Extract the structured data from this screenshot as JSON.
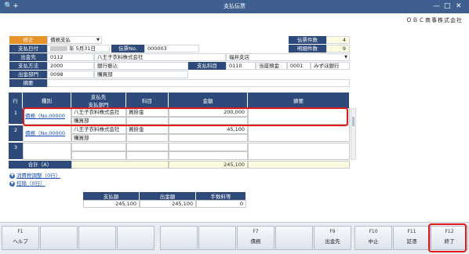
{
  "window": {
    "title": "支払伝票",
    "app_icon": "🔍+",
    "company": "ＯＢＣ商事株式会社"
  },
  "header": {
    "mode_label": "修正",
    "mode_value": "債務支払",
    "date_label": "支払日付",
    "date_value": "年  5月31日",
    "slip_no_label": "伝票No.",
    "slip_no_value": "000003",
    "payee_label": "出金先",
    "payee_code": "0112",
    "payee_name": "八王子衣料株式会社",
    "payee_branch": "福井支店",
    "method_label": "支払方法",
    "method_code": "2000",
    "method_name": "銀行振込",
    "account_label": "支払科目",
    "account_code": "0110",
    "account_name": "当座預金",
    "bank_code": "0001",
    "bank_name": "みずほ銀行",
    "dept_label": "出金部門",
    "dept_code": "0098",
    "dept_name": "購買部",
    "memo_label": "摘要",
    "slip_count_label": "伝票件数",
    "slip_count": "4",
    "detail_count_label": "明細件数",
    "detail_count": "9"
  },
  "grid": {
    "headers": {
      "row": "行",
      "kind": "種別",
      "payee_top": "支払先",
      "payee_bottom": "支払部門",
      "item": "科目",
      "amount": "金額",
      "memo": "摘要"
    },
    "rows": [
      {
        "no": "1",
        "kind": "債務（No.00000",
        "payee": "八王子衣料株式会社",
        "item": "買掛金",
        "dept": "購買部",
        "amount": "200,000"
      },
      {
        "no": "2",
        "kind": "債務（No.00000",
        "payee": "八王子衣料株式会社",
        "item": "買掛金",
        "dept": "購買部",
        "amount": "45,100"
      },
      {
        "no": "3",
        "kind": "",
        "payee": "",
        "item": "",
        "dept": "",
        "amount": ""
      }
    ],
    "total_label": "合計（A）",
    "total_amount": "245,100"
  },
  "links": {
    "tax_adjust": "消費税調整（0行）",
    "deduction": "控除（0行）"
  },
  "summary": {
    "headers": [
      "支払額",
      "出金額",
      "手数料等"
    ],
    "values": [
      "245,100",
      "245,100",
      "0"
    ]
  },
  "fkeys": [
    {
      "key": "F1",
      "label": "ヘルプ"
    },
    {
      "key": "",
      "label": ""
    },
    {
      "key": "",
      "label": ""
    },
    {
      "key": "",
      "label": ""
    },
    {
      "key": "",
      "label": ""
    },
    {
      "key": "",
      "label": ""
    },
    {
      "key": "F7",
      "label": "債務"
    },
    {
      "key": "",
      "label": ""
    },
    {
      "key": "F9",
      "label": "出金先"
    },
    {
      "key": "F10",
      "label": "中止"
    },
    {
      "key": "F11",
      "label": "証憑"
    },
    {
      "key": "F12",
      "label": "終了"
    }
  ]
}
